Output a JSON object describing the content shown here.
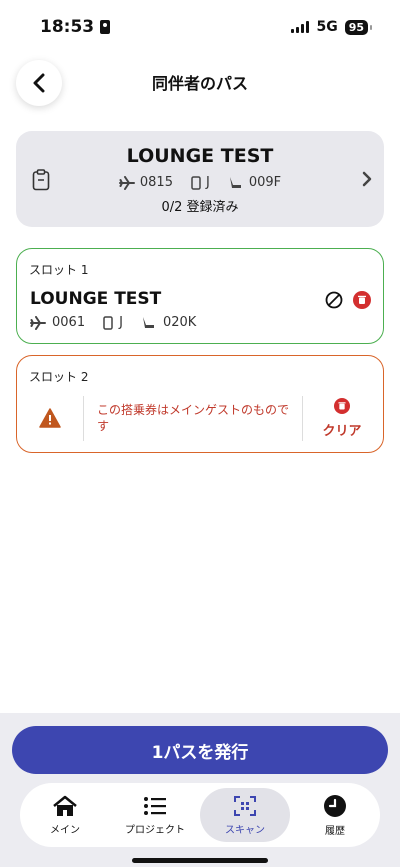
{
  "status_bar": {
    "time": "18:53",
    "network": "5G",
    "battery": "95"
  },
  "header": {
    "title": "同伴者のパス"
  },
  "summary": {
    "title": "LOUNGE TEST",
    "flight": "0815",
    "class": "J",
    "seat": "009F",
    "registered": "0/2 登録済み"
  },
  "slots": [
    {
      "label": "スロット 1",
      "name": "LOUNGE TEST",
      "flight": "0061",
      "class": "J",
      "seat": "020K"
    },
    {
      "label": "スロット 2",
      "warning": "この搭乗券はメインゲストのものです",
      "clear_label": "クリア"
    }
  ],
  "issue_button": {
    "label": "1パスを発行"
  },
  "tabs": [
    {
      "label": "メイン",
      "icon": "home-icon"
    },
    {
      "label": "プロジェクト",
      "icon": "list-icon"
    },
    {
      "label": "スキャン",
      "icon": "scan-icon"
    },
    {
      "label": "履歴",
      "icon": "clock-icon"
    }
  ],
  "colors": {
    "accent": "#3d46b0",
    "success_border": "#4caf50",
    "warning_border": "#d9652a",
    "danger": "#d32f2f"
  }
}
